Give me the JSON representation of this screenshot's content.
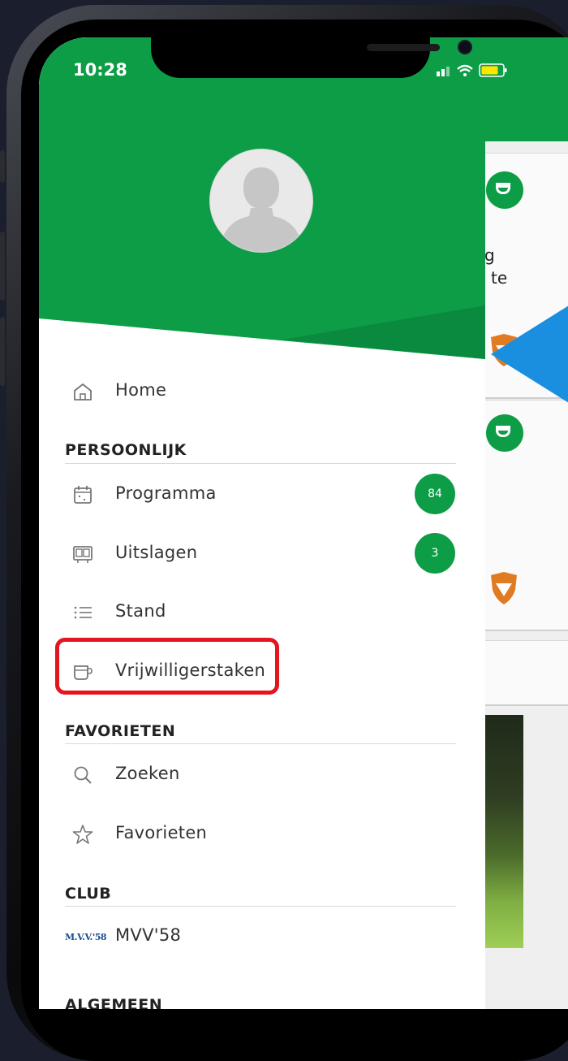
{
  "status_bar": {
    "time": "10:28"
  },
  "menu": {
    "home": "Home",
    "sections": {
      "persoonlijk": "PERSOONLIJK",
      "favorieten": "FAVORIETEN",
      "club": "CLUB",
      "algemeen": "ALGEMEEN"
    },
    "items": {
      "programma": {
        "label": "Programma",
        "badge": "84"
      },
      "uitslagen": {
        "label": "Uitslagen",
        "badge": "3"
      },
      "stand": {
        "label": "Stand"
      },
      "vrijwilligerstaken": {
        "label": "Vrijwilligerstaken"
      },
      "zoeken": {
        "label": "Zoeken"
      },
      "favorieten": {
        "label": "Favorieten"
      },
      "mvv58": {
        "label": "MVV'58",
        "logo_text": "M.V.V.'58"
      }
    }
  },
  "background_app": {
    "text_line1": "g",
    "text_line2": "te"
  },
  "colors": {
    "brand_green": "#0c9d46",
    "highlight_red": "#e3151f",
    "arrow_blue": "#1a8fe0",
    "club_orange": "#e07b22"
  }
}
